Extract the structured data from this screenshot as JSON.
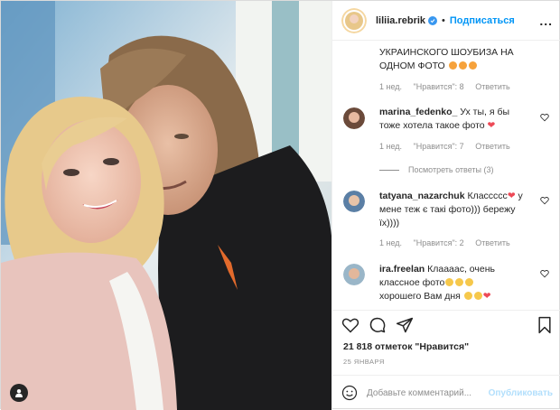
{
  "header": {
    "username": "liliia.rebrik",
    "dot": "•",
    "follow_label": "Подписаться",
    "more": "..."
  },
  "caption": {
    "text_line1": "УКРАИНСКОГО ШОУБИЗА НА",
    "text_line2": "ОДНОМ ФОТО",
    "emoji": "😍😍😍",
    "time": "1 нед.",
    "likes": "\"Нравится\": 8",
    "reply": "Ответить"
  },
  "comments": [
    {
      "username": "marina_fedenko_",
      "text_line1": "Ух ты, я бы",
      "text_line2": "тоже хотела такое фото",
      "emoji": "❤",
      "time": "1 нед.",
      "likes": "\"Нравится\": 7",
      "reply": "Ответить",
      "view_replies": "Посмотреть ответы (3)"
    },
    {
      "username": "tatyana_nazarchuk",
      "text_line1": "Классссс",
      "emoji_heart": "❤",
      "text_line1b": "у",
      "text_line2": "мене теж є такі фото))) бережу",
      "text_line3": "їх))))",
      "time": "1 нед.",
      "likes": "\"Нравится\": 2",
      "reply": "Ответить"
    },
    {
      "username": "ira.freelan",
      "text_line1": "Клаааас, очень",
      "text_line2": "классное фото",
      "emoji2": "😊😊😊",
      "text_line3": "хорошего Вам дня",
      "emoji3": "😊😊❤"
    }
  ],
  "actions": {
    "likes_text": "21 818 отметок \"Нравится\"",
    "date": "25 ЯНВАРЯ"
  },
  "add_comment": {
    "placeholder": "Добавьте комментарий...",
    "publish": "Опубликовать"
  },
  "icons": [
    "heart-icon",
    "comment-icon",
    "share-icon",
    "bookmark-icon",
    "smiley-icon",
    "user-tag-icon",
    "verified-icon"
  ],
  "colors": {
    "link": "#0095f6",
    "verified": "#3897f0",
    "heart": "#ed4956",
    "muted": "#8e8e8e"
  }
}
